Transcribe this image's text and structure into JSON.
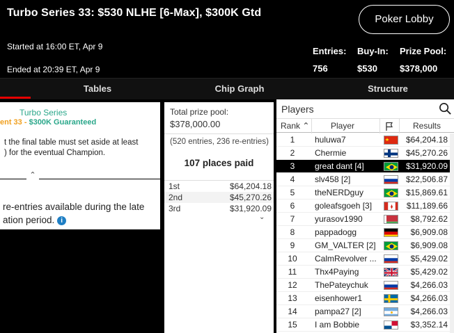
{
  "header": {
    "title": "Turbo Series 33: $530 NLHE [6-Max], $300K Gtd",
    "started": "Started at 16:00 ET, Apr 9",
    "ended": "Ended at 20:39 ET, Apr 9",
    "lobby_button": "Poker Lobby",
    "stats": [
      {
        "label": "Entries:",
        "value": "756"
      },
      {
        "label": "Buy-In:",
        "value": "$530"
      },
      {
        "label": "Prize Pool:",
        "value": "$378,000"
      }
    ]
  },
  "tabs": [
    "Tables",
    "Chip Graph",
    "Structure"
  ],
  "info": {
    "series": "Turbo Series",
    "event_prefix": "ent 33 - ",
    "event_suffix": "$300K Guaranteed",
    "desc": "t the final table must set aside at least\n) for the eventual Champion.",
    "reentry": "re-entries available during the late\nation period."
  },
  "prize": {
    "label": "Total prize pool:",
    "pool": "$378,000.00",
    "entries": "(520 entries, 236 re-entries)",
    "paid": "107 places paid",
    "places": [
      {
        "place": "1st",
        "amount": "$64,204.18"
      },
      {
        "place": "2nd",
        "amount": "$45,270.26"
      },
      {
        "place": "3rd",
        "amount": "$31,920.09"
      }
    ]
  },
  "players": {
    "title": "Players",
    "headers": {
      "rank": "Rank",
      "player": "Player",
      "results": "Results"
    },
    "rows": [
      {
        "rank": "1",
        "name": "huluwa7",
        "flag": "cn",
        "result": "$64,204.18"
      },
      {
        "rank": "2",
        "name": "Chermie",
        "flag": "fi",
        "result": "$45,270.26"
      },
      {
        "rank": "3",
        "name": "great dant [4]",
        "flag": "br",
        "result": "$31,920.09"
      },
      {
        "rank": "4",
        "name": "slv458 [2]",
        "flag": "ru",
        "result": "$22,506.87"
      },
      {
        "rank": "5",
        "name": "theNERDguy",
        "flag": "br",
        "result": "$15,869.61"
      },
      {
        "rank": "6",
        "name": "goleafsgoeh [3]",
        "flag": "ca",
        "result": "$11,189.66"
      },
      {
        "rank": "7",
        "name": "yurasov1990",
        "flag": "by",
        "result": "$8,792.62"
      },
      {
        "rank": "8",
        "name": "pappadogg",
        "flag": "de",
        "result": "$6,909.08"
      },
      {
        "rank": "9",
        "name": "GM_VALTER [2]",
        "flag": "br",
        "result": "$6,909.08"
      },
      {
        "rank": "10",
        "name": "CalmRevolver ...",
        "flag": "ru",
        "result": "$5,429.02"
      },
      {
        "rank": "11",
        "name": "Thx4Paying",
        "flag": "gb",
        "result": "$5,429.02"
      },
      {
        "rank": "12",
        "name": "ThePateychuk",
        "flag": "ru",
        "result": "$4,266.03"
      },
      {
        "rank": "13",
        "name": "eisenhower1",
        "flag": "se",
        "result": "$4,266.03"
      },
      {
        "rank": "14",
        "name": "pampa27 [2]",
        "flag": "ar",
        "result": "$4,266.03"
      },
      {
        "rank": "15",
        "name": "I am Bobbie",
        "flag": "pa",
        "result": "$3,352.14"
      }
    ],
    "selected_rank": "3"
  },
  "colors": {
    "accent_red": "#e60000",
    "series_green": "#2aa78a",
    "event_orange": "#f0a020",
    "info_blue": "#1f7fc4"
  }
}
